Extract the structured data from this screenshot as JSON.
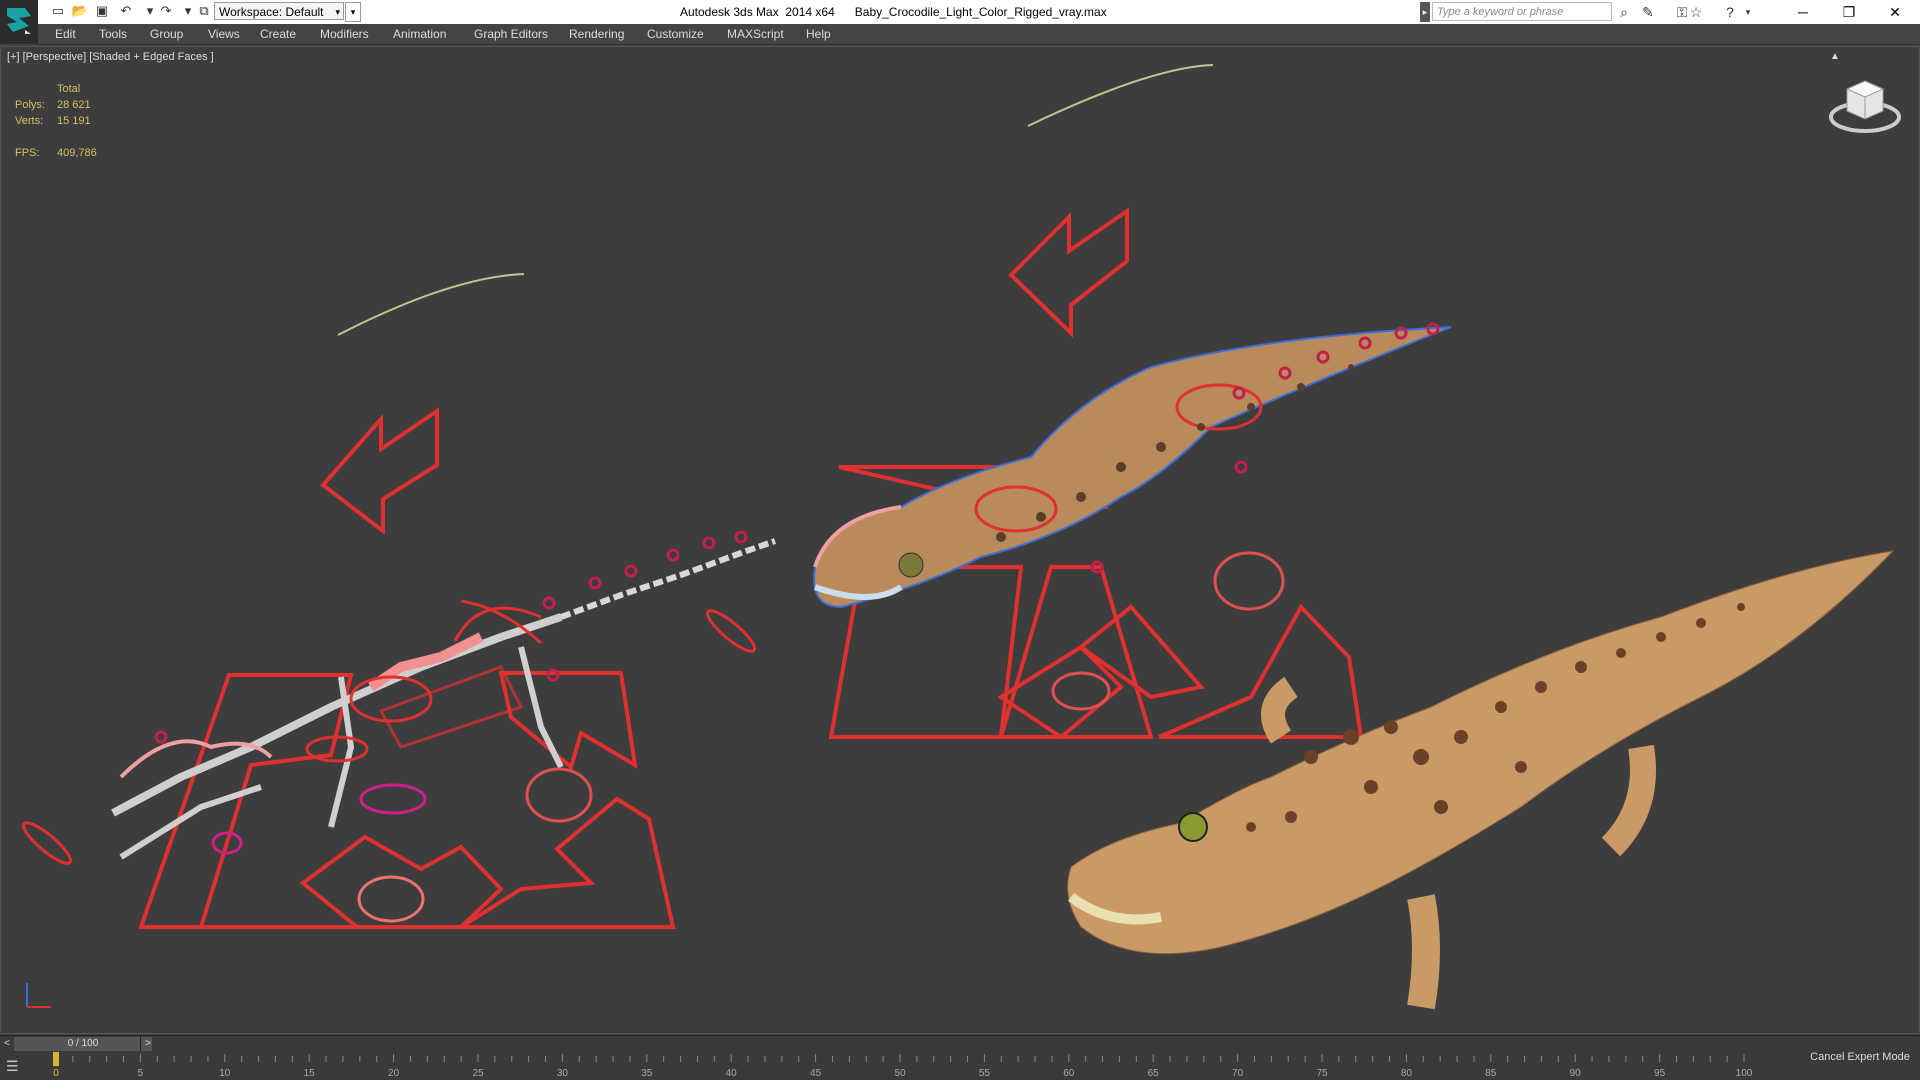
{
  "titlebar": {
    "workspace_label": "Workspace: Default",
    "app_title": "Autodesk 3ds Max  2014 x64",
    "file_name": "Baby_Crocodile_Light_Color_Rigged_vray.max",
    "search_placeholder": "Type a keyword or phrase",
    "quick_access_icons": [
      "new-file-icon",
      "open-file-icon",
      "save-icon",
      "undo-icon",
      "redo-icon",
      "project-folder-icon"
    ],
    "toolbar_icons": [
      "binoculars-icon",
      "search-tools-icon",
      "key-icon",
      "favorite-star-icon",
      "help-icon"
    ],
    "window_controls": {
      "minimize": "─",
      "restore": "❐",
      "close": "✕"
    }
  },
  "menu": {
    "items": [
      "Edit",
      "Tools",
      "Group",
      "Views",
      "Create",
      "Modifiers",
      "Animation",
      "Graph Editors",
      "Rendering",
      "Customize",
      "MAXScript",
      "Help"
    ]
  },
  "viewport": {
    "label": "[+] [Perspective] [Shaded + Edged Faces ]",
    "stats": {
      "header": "Total",
      "polys_label": "Polys:",
      "polys_value": "28 621",
      "verts_label": "Verts:",
      "verts_value": "15 191",
      "fps_label": "FPS:",
      "fps_value": "409,786"
    },
    "colors": {
      "background": "#3d3d3d",
      "controls": "#e03030",
      "wire": "#3a6fd8",
      "skin": "#c99a66",
      "stats": "#d8c060"
    }
  },
  "timeline": {
    "frame_display": "0 / 100",
    "prev_label": "<",
    "next_label": ">",
    "ticks": [
      "0",
      "5",
      "10",
      "15",
      "20",
      "25",
      "30",
      "35",
      "40",
      "45",
      "50",
      "55",
      "60",
      "65",
      "70",
      "75",
      "80",
      "85",
      "90",
      "95",
      "100"
    ],
    "current_frame": 0,
    "total_frames": 100
  },
  "status": {
    "cancel_expert_mode": "Cancel Expert Mode"
  }
}
